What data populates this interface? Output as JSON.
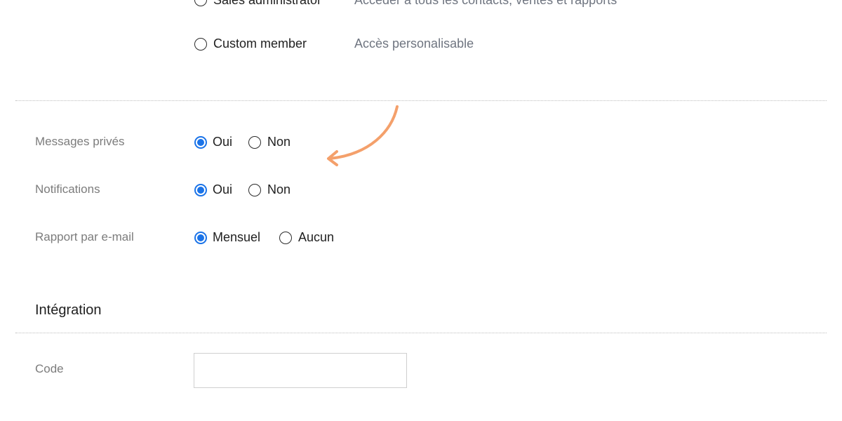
{
  "roles": [
    {
      "label": "Sales administrator",
      "description": "Accéder à tous les contacts, ventes et rapports",
      "selected": false
    },
    {
      "label": "Custom member",
      "description": "Accès personalisable",
      "selected": false
    }
  ],
  "settings": {
    "private_messages": {
      "label": "Messages privés",
      "option_yes": "Oui",
      "option_no": "Non",
      "selected": "Oui"
    },
    "notifications": {
      "label": "Notifications",
      "option_yes": "Oui",
      "option_no": "Non",
      "selected": "Oui"
    },
    "email_report": {
      "label": "Rapport par e-mail",
      "option_monthly": "Mensuel",
      "option_none": "Aucun",
      "selected": "Mensuel"
    }
  },
  "integration": {
    "title": "Intégration",
    "code_label": "Code",
    "code_value": "",
    "code_placeholder": ""
  },
  "colors": {
    "accent": "#1a73e8",
    "annotation_arrow": "#f4a06b"
  },
  "icons": {
    "annotation": "curved-arrow-icon"
  }
}
